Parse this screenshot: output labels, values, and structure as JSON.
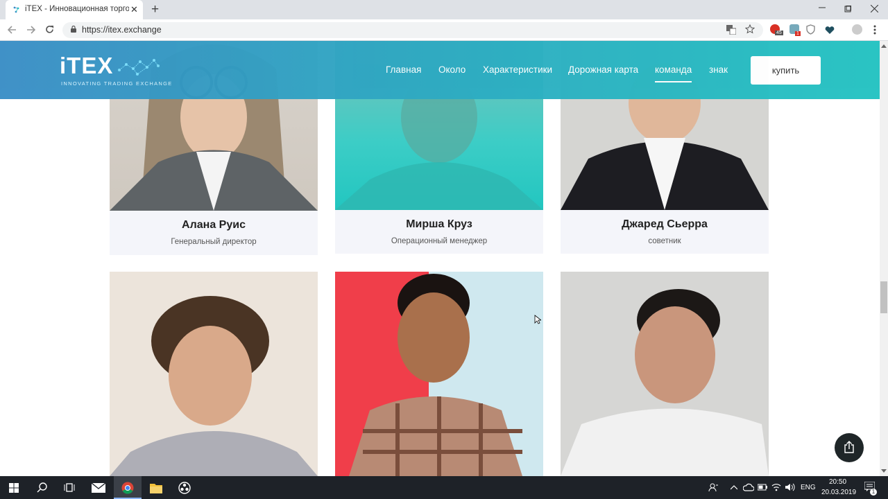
{
  "browser": {
    "tab_title": "iTEX - Инновационная торговая",
    "url": "https://itex.exchange",
    "new_tab_symbol": "+",
    "close_symbol": "✕",
    "ext_badge_1": "1",
    "ext_badge_2": "45"
  },
  "site": {
    "logo_text": "iTEX",
    "logo_tagline": "INNOVATING TRADING EXCHANGE",
    "nav": {
      "home": "Главная",
      "about": "Около",
      "features": "Характеристики",
      "roadmap": "Дорожная карта",
      "team": "команда",
      "token": "знак"
    },
    "buy_label": "купить",
    "team": [
      {
        "name": "Алана Руис",
        "role": "Генеральный директор"
      },
      {
        "name": "Мирша Круз",
        "role": "Операционный менеджер"
      },
      {
        "name": "Джаред Сьерра",
        "role": "советник"
      }
    ]
  },
  "taskbar": {
    "language": "ENG",
    "time": "20:50",
    "date": "20.03.2019",
    "notification_count": "1"
  },
  "colors": {
    "header_gradient_start": "#3a8ec6",
    "header_gradient_end": "#24c3c2",
    "card_bg": "#f4f5fa",
    "taskbar_bg": "#1e2228"
  }
}
